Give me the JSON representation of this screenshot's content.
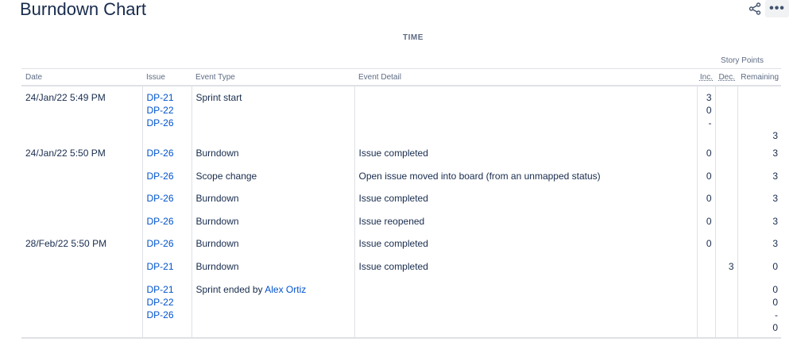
{
  "page": {
    "title": "Burndown Chart",
    "time_label": "TIME"
  },
  "toolbar": {
    "more_label": "•••"
  },
  "table": {
    "group_header": "Story Points",
    "columns": {
      "date": "Date",
      "issue": "Issue",
      "event_type": "Event Type",
      "event_detail": "Event Detail",
      "inc": "Inc.",
      "dec": "Dec.",
      "remaining": "Remaining"
    },
    "rows": [
      {
        "date": "24/Jan/22 5:49 PM",
        "issues": [
          "DP-21",
          "DP-22",
          "DP-26"
        ],
        "event_type": "Sprint start",
        "event_detail": "",
        "inc": [
          "3",
          "0",
          "-"
        ],
        "dec": [],
        "remaining": [
          "",
          "",
          "",
          "3"
        ]
      },
      {
        "date": "24/Jan/22 5:50 PM",
        "issues": [
          "DP-26"
        ],
        "event_type": "Burndown",
        "event_detail": "Issue completed",
        "inc": [
          "0"
        ],
        "dec": [],
        "remaining": [
          "3"
        ]
      },
      {
        "date": "",
        "issues": [
          "DP-26"
        ],
        "event_type": "Scope change",
        "event_detail": "Open issue moved into board (from an unmapped status)",
        "inc": [
          "0"
        ],
        "dec": [],
        "remaining": [
          "3"
        ]
      },
      {
        "date": "",
        "issues": [
          "DP-26"
        ],
        "event_type": "Burndown",
        "event_detail": "Issue completed",
        "inc": [
          "0"
        ],
        "dec": [],
        "remaining": [
          "3"
        ]
      },
      {
        "date": "",
        "issues": [
          "DP-26"
        ],
        "event_type": "Burndown",
        "event_detail": "Issue reopened",
        "inc": [
          "0"
        ],
        "dec": [],
        "remaining": [
          "3"
        ]
      },
      {
        "date": "28/Feb/22 5:50 PM",
        "issues": [
          "DP-26"
        ],
        "event_type": "Burndown",
        "event_detail": "Issue completed",
        "inc": [
          "0"
        ],
        "dec": [],
        "remaining": [
          "3"
        ]
      },
      {
        "date": "",
        "issues": [
          "DP-21"
        ],
        "event_type": "Burndown",
        "event_detail": "Issue completed",
        "inc": [],
        "dec": [
          "3"
        ],
        "remaining": [
          "0"
        ]
      },
      {
        "date": "",
        "issues": [
          "DP-21",
          "DP-22",
          "DP-26"
        ],
        "event_type": "Sprint ended by",
        "event_user": "Alex Ortiz",
        "event_detail": "",
        "inc": [],
        "dec": [],
        "remaining": [
          "0",
          "0",
          "-",
          "0"
        ]
      }
    ]
  }
}
